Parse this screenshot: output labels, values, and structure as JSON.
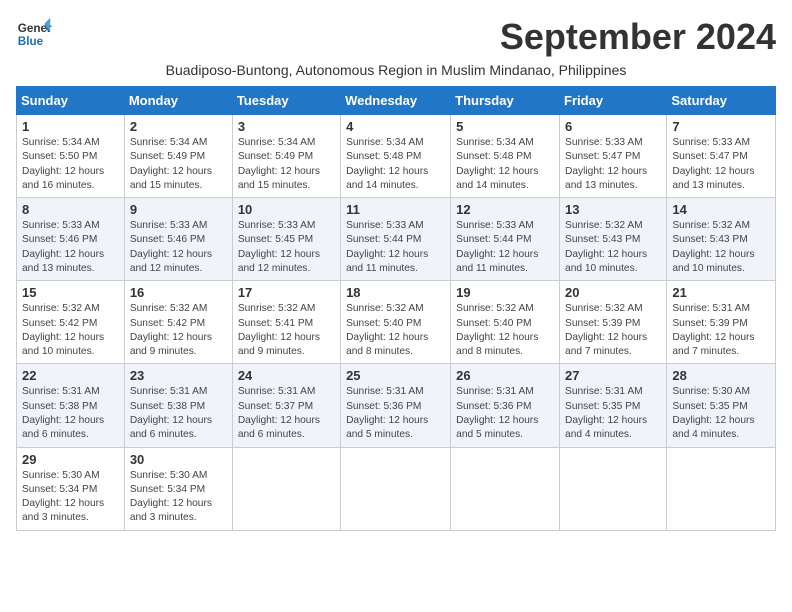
{
  "header": {
    "logo_line1": "General",
    "logo_line2": "Blue",
    "month_title": "September 2024",
    "subtitle": "Buadiposo-Buntong, Autonomous Region in Muslim Mindanao, Philippines"
  },
  "weekdays": [
    "Sunday",
    "Monday",
    "Tuesday",
    "Wednesday",
    "Thursday",
    "Friday",
    "Saturday"
  ],
  "weeks": [
    [
      {
        "day": "1",
        "info": "Sunrise: 5:34 AM\nSunset: 5:50 PM\nDaylight: 12 hours\nand 16 minutes."
      },
      {
        "day": "2",
        "info": "Sunrise: 5:34 AM\nSunset: 5:49 PM\nDaylight: 12 hours\nand 15 minutes."
      },
      {
        "day": "3",
        "info": "Sunrise: 5:34 AM\nSunset: 5:49 PM\nDaylight: 12 hours\nand 15 minutes."
      },
      {
        "day": "4",
        "info": "Sunrise: 5:34 AM\nSunset: 5:48 PM\nDaylight: 12 hours\nand 14 minutes."
      },
      {
        "day": "5",
        "info": "Sunrise: 5:34 AM\nSunset: 5:48 PM\nDaylight: 12 hours\nand 14 minutes."
      },
      {
        "day": "6",
        "info": "Sunrise: 5:33 AM\nSunset: 5:47 PM\nDaylight: 12 hours\nand 13 minutes."
      },
      {
        "day": "7",
        "info": "Sunrise: 5:33 AM\nSunset: 5:47 PM\nDaylight: 12 hours\nand 13 minutes."
      }
    ],
    [
      {
        "day": "8",
        "info": "Sunrise: 5:33 AM\nSunset: 5:46 PM\nDaylight: 12 hours\nand 13 minutes."
      },
      {
        "day": "9",
        "info": "Sunrise: 5:33 AM\nSunset: 5:46 PM\nDaylight: 12 hours\nand 12 minutes."
      },
      {
        "day": "10",
        "info": "Sunrise: 5:33 AM\nSunset: 5:45 PM\nDaylight: 12 hours\nand 12 minutes."
      },
      {
        "day": "11",
        "info": "Sunrise: 5:33 AM\nSunset: 5:44 PM\nDaylight: 12 hours\nand 11 minutes."
      },
      {
        "day": "12",
        "info": "Sunrise: 5:33 AM\nSunset: 5:44 PM\nDaylight: 12 hours\nand 11 minutes."
      },
      {
        "day": "13",
        "info": "Sunrise: 5:32 AM\nSunset: 5:43 PM\nDaylight: 12 hours\nand 10 minutes."
      },
      {
        "day": "14",
        "info": "Sunrise: 5:32 AM\nSunset: 5:43 PM\nDaylight: 12 hours\nand 10 minutes."
      }
    ],
    [
      {
        "day": "15",
        "info": "Sunrise: 5:32 AM\nSunset: 5:42 PM\nDaylight: 12 hours\nand 10 minutes."
      },
      {
        "day": "16",
        "info": "Sunrise: 5:32 AM\nSunset: 5:42 PM\nDaylight: 12 hours\nand 9 minutes."
      },
      {
        "day": "17",
        "info": "Sunrise: 5:32 AM\nSunset: 5:41 PM\nDaylight: 12 hours\nand 9 minutes."
      },
      {
        "day": "18",
        "info": "Sunrise: 5:32 AM\nSunset: 5:40 PM\nDaylight: 12 hours\nand 8 minutes."
      },
      {
        "day": "19",
        "info": "Sunrise: 5:32 AM\nSunset: 5:40 PM\nDaylight: 12 hours\nand 8 minutes."
      },
      {
        "day": "20",
        "info": "Sunrise: 5:32 AM\nSunset: 5:39 PM\nDaylight: 12 hours\nand 7 minutes."
      },
      {
        "day": "21",
        "info": "Sunrise: 5:31 AM\nSunset: 5:39 PM\nDaylight: 12 hours\nand 7 minutes."
      }
    ],
    [
      {
        "day": "22",
        "info": "Sunrise: 5:31 AM\nSunset: 5:38 PM\nDaylight: 12 hours\nand 6 minutes."
      },
      {
        "day": "23",
        "info": "Sunrise: 5:31 AM\nSunset: 5:38 PM\nDaylight: 12 hours\nand 6 minutes."
      },
      {
        "day": "24",
        "info": "Sunrise: 5:31 AM\nSunset: 5:37 PM\nDaylight: 12 hours\nand 6 minutes."
      },
      {
        "day": "25",
        "info": "Sunrise: 5:31 AM\nSunset: 5:36 PM\nDaylight: 12 hours\nand 5 minutes."
      },
      {
        "day": "26",
        "info": "Sunrise: 5:31 AM\nSunset: 5:36 PM\nDaylight: 12 hours\nand 5 minutes."
      },
      {
        "day": "27",
        "info": "Sunrise: 5:31 AM\nSunset: 5:35 PM\nDaylight: 12 hours\nand 4 minutes."
      },
      {
        "day": "28",
        "info": "Sunrise: 5:30 AM\nSunset: 5:35 PM\nDaylight: 12 hours\nand 4 minutes."
      }
    ],
    [
      {
        "day": "29",
        "info": "Sunrise: 5:30 AM\nSunset: 5:34 PM\nDaylight: 12 hours\nand 3 minutes."
      },
      {
        "day": "30",
        "info": "Sunrise: 5:30 AM\nSunset: 5:34 PM\nDaylight: 12 hours\nand 3 minutes."
      },
      {
        "day": "",
        "info": ""
      },
      {
        "day": "",
        "info": ""
      },
      {
        "day": "",
        "info": ""
      },
      {
        "day": "",
        "info": ""
      },
      {
        "day": "",
        "info": ""
      }
    ]
  ]
}
